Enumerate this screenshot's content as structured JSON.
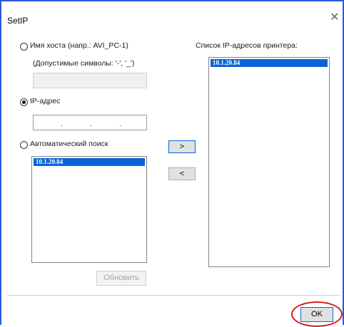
{
  "window": {
    "title": "SetIP",
    "close_glyph": "✕"
  },
  "hostname": {
    "label": "Имя хоста (напр.: AVI_PC-1)",
    "hint": "(Допустимые символы: '-', '_')",
    "value": ""
  },
  "ip": {
    "label": "IP-адрес",
    "value": "",
    "dots": [
      ".",
      ".",
      "."
    ],
    "selected": true
  },
  "auto_search": {
    "label": "Автоматический поиск",
    "found": [
      "10.1.20.84"
    ],
    "refresh_label": "Обновить"
  },
  "transfer": {
    "add_label": ">",
    "remove_label": "<"
  },
  "printer_list": {
    "title": "Список IP-адресов принтера:",
    "items": [
      "10.1.20.84"
    ]
  },
  "footer": {
    "ok_label": "OK"
  },
  "colors": {
    "accent": "#0a64d8",
    "highlight_circle": "#d61b1b"
  }
}
